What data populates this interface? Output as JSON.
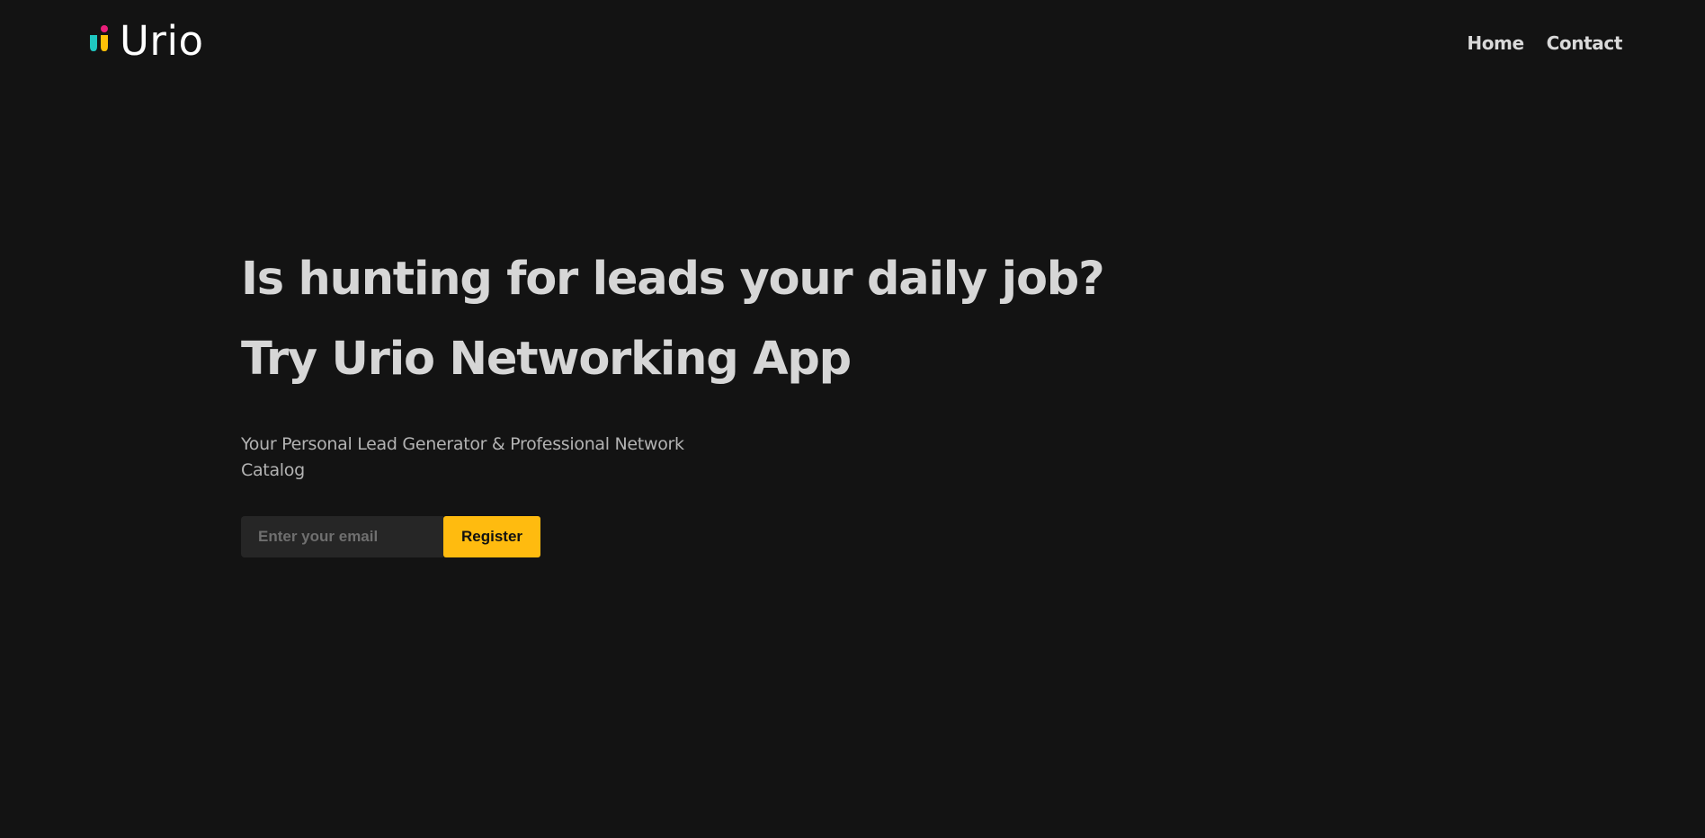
{
  "brand": {
    "name": "Urio",
    "icon": "urio-logo-icon",
    "colors": {
      "teal": "#1fc7c1",
      "yellow": "#ffc107",
      "pink": "#e91e7a"
    }
  },
  "nav": {
    "items": [
      {
        "label": "Home"
      },
      {
        "label": "Contact"
      }
    ]
  },
  "hero": {
    "headline_1": "Is hunting for leads your daily job?",
    "headline_2": "Try Urio Networking App",
    "subtitle": "Your Personal Lead Generator & Professional Network Catalog",
    "signup": {
      "email_placeholder": "Enter your email",
      "email_value": "",
      "register_label": "Register"
    }
  },
  "colors": {
    "background": "#131313",
    "accent": "#ffbb0f"
  }
}
